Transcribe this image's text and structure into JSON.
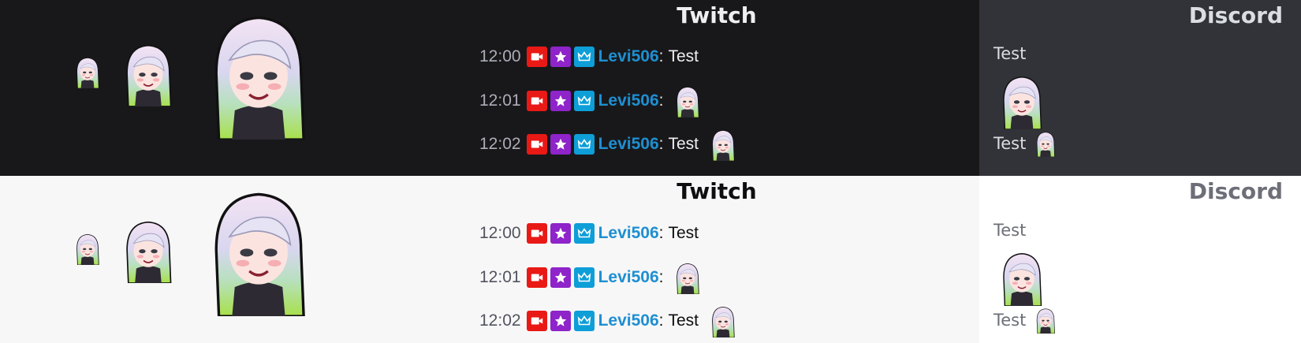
{
  "dark": {
    "twitch_title": "Twitch",
    "discord_title": "Discord",
    "chat": [
      {
        "time": "12:00",
        "user": "Levi506",
        "colon": ":",
        "text": "Test"
      },
      {
        "time": "12:01",
        "user": "Levi506",
        "colon": ":",
        "text": ""
      },
      {
        "time": "12:02",
        "user": "Levi506",
        "colon": ":",
        "text": "Test"
      }
    ],
    "discord": {
      "line1": "Test",
      "line3": "Test"
    }
  },
  "light": {
    "twitch_title": "Twitch",
    "discord_title": "Discord",
    "chat": [
      {
        "time": "12:00",
        "user": "Levi506",
        "colon": ":",
        "text": "Test"
      },
      {
        "time": "12:01",
        "user": "Levi506",
        "colon": ":",
        "text": ""
      },
      {
        "time": "12:02",
        "user": "Levi506",
        "colon": ":",
        "text": "Test"
      }
    ],
    "discord": {
      "line1": "Test",
      "line3": "Test"
    }
  },
  "icons": {
    "badge1": "camera-badge-icon",
    "badge2": "star-badge-icon",
    "badge3": "crown-badge-icon",
    "emote": "anime-girl-emote-icon"
  },
  "colors": {
    "username": "#1e8fd1",
    "badge_cam": "#e91916",
    "badge_star": "#8e24c9",
    "badge_crown": "#0e9ed8"
  }
}
